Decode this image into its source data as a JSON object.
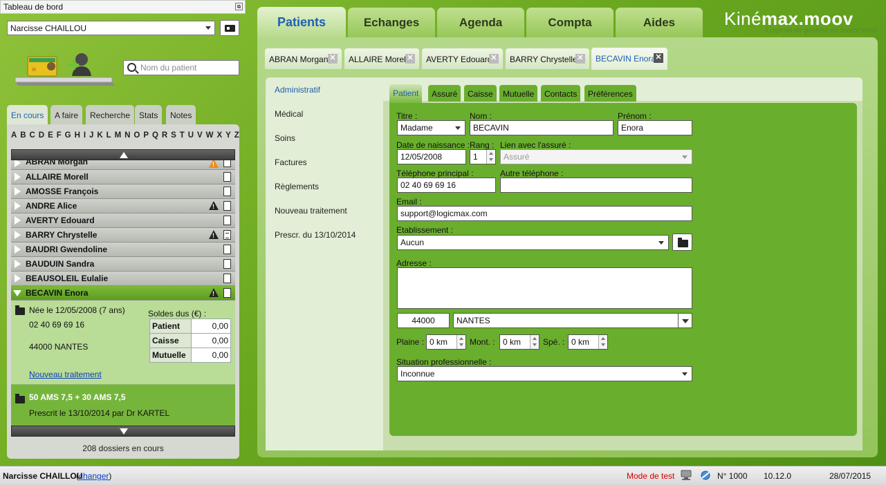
{
  "dashboard": {
    "title": "Tableau de bord",
    "pin_icon": "pin-icon"
  },
  "user_select": {
    "value": "Narcisse CHAILLOU"
  },
  "search": {
    "placeholder": "Nom du patient"
  },
  "left_tabs": [
    {
      "label": "En cours",
      "active": true
    },
    {
      "label": "A faire"
    },
    {
      "label": "Recherche"
    },
    {
      "label": "Stats"
    },
    {
      "label": "Notes"
    }
  ],
  "alphabet": [
    "A",
    "B",
    "C",
    "D",
    "E",
    "F",
    "G",
    "H",
    "I",
    "J",
    "K",
    "L",
    "M",
    "N",
    "O",
    "P",
    "Q",
    "R",
    "S",
    "T",
    "U",
    "V",
    "W",
    "X",
    "Y",
    "Z"
  ],
  "patients": [
    {
      "name": "ABRAN Morgan",
      "warn": "orange",
      "doc": "plain"
    },
    {
      "name": "ALLAIRE Morell",
      "doc": "plain"
    },
    {
      "name": "AMOSSE François",
      "doc": "plain"
    },
    {
      "name": "ANDRE Alice",
      "warn": "black",
      "doc": "plain"
    },
    {
      "name": "AVERTY Edouard",
      "doc": "plain"
    },
    {
      "name": "BARRY Chrystelle",
      "warn": "black",
      "doc": "lines"
    },
    {
      "name": "BAUDRI Gwendoline",
      "doc": "plain"
    },
    {
      "name": "BAUDUIN Sandra",
      "doc": "plain"
    },
    {
      "name": "BEAUSOLEIL Eulalie",
      "doc": "plain"
    },
    {
      "name": "BECAVIN Enora",
      "warn": "black",
      "doc": "plain",
      "selected": true
    }
  ],
  "detail": {
    "birth": "Née le 12/05/2008 (7 ans)",
    "phone": "02 40 69 69 16",
    "address": "44000 NANTES",
    "soldes_title": "Soldes dus (€) :",
    "soldes": [
      {
        "label": "Patient",
        "value": "0,00"
      },
      {
        "label": "Caisse",
        "value": "0,00"
      },
      {
        "label": "Mutuelle",
        "value": "0,00"
      }
    ],
    "new_treatment": "Nouveau traitement"
  },
  "treatment": {
    "title": "50 AMS 7,5 + 30 AMS 7,5",
    "prescribed": "Prescrit le 13/10/2014 par Dr KARTEL"
  },
  "dossiers_count": "208 dossiers en cours",
  "main_tabs": [
    {
      "label": "Patients",
      "active": true
    },
    {
      "label": "Echanges"
    },
    {
      "label": "Agenda"
    },
    {
      "label": "Compta"
    },
    {
      "label": "Aides"
    }
  ],
  "logo": {
    "kine": "Kiné",
    "max": "max",
    "moov": ".moov",
    "tagline": "Logiciel de gestion en moov'ment"
  },
  "patient_tabs": [
    {
      "label": "ABRAN Morgan"
    },
    {
      "label": "ALLAIRE Morell"
    },
    {
      "label": "AVERTY Edouard"
    },
    {
      "label": "BARRY Chrystelle"
    },
    {
      "label": "BECAVIN Enora",
      "active": true
    }
  ],
  "side_nav": [
    {
      "label": "Administratif",
      "active": true
    },
    {
      "label": "Médical"
    },
    {
      "label": "Soins"
    },
    {
      "label": "Factures"
    },
    {
      "label": "Règlements"
    },
    {
      "label": "Nouveau traitement"
    },
    {
      "label": "Prescr. du 13/10/2014"
    }
  ],
  "inner_tabs": [
    {
      "label": "Patient",
      "active": true
    },
    {
      "label": "Assuré"
    },
    {
      "label": "Caisse"
    },
    {
      "label": "Mutuelle"
    },
    {
      "label": "Contacts"
    },
    {
      "label": "Préférences"
    }
  ],
  "form": {
    "titre_label": "Titre :",
    "titre_value": "Madame",
    "nom_label": "Nom :",
    "nom_value": "BECAVIN",
    "prenom_label": "Prénom :",
    "prenom_value": "Enora",
    "dob_label": "Date de naissance :",
    "dob_value": "12/05/2008",
    "rang_label": "Rang :",
    "rang_value": "1",
    "lien_label": "Lien avec l'assuré :",
    "lien_value": "Assuré",
    "tel_label": "Téléphone principal :",
    "tel_value": "02 40 69 69 16",
    "tel2_label": "Autre téléphone :",
    "tel2_value": "",
    "email_label": "Email :",
    "email_value": "support@logicmax.com",
    "etab_label": "Etablissement :",
    "etab_value": "Aucun",
    "adresse_label": "Adresse :",
    "adresse_value": "",
    "cp_value": "44000",
    "ville_value": "NANTES",
    "plaine_label": "Plaine :",
    "plaine_value": "0 km",
    "mont_label": "Mont. :",
    "mont_value": "0 km",
    "spe_label": "Spé. :",
    "spe_value": "0 km",
    "situation_label": "Situation professionnelle :",
    "situation_value": "Inconnue"
  },
  "status": {
    "user": "Narcisse CHAILLOU",
    "change_link": "changer",
    "mode": "Mode de test",
    "number": "N° 1000",
    "version": "10.12.0",
    "date": "28/07/2015",
    "mode_color": "#d40000"
  }
}
